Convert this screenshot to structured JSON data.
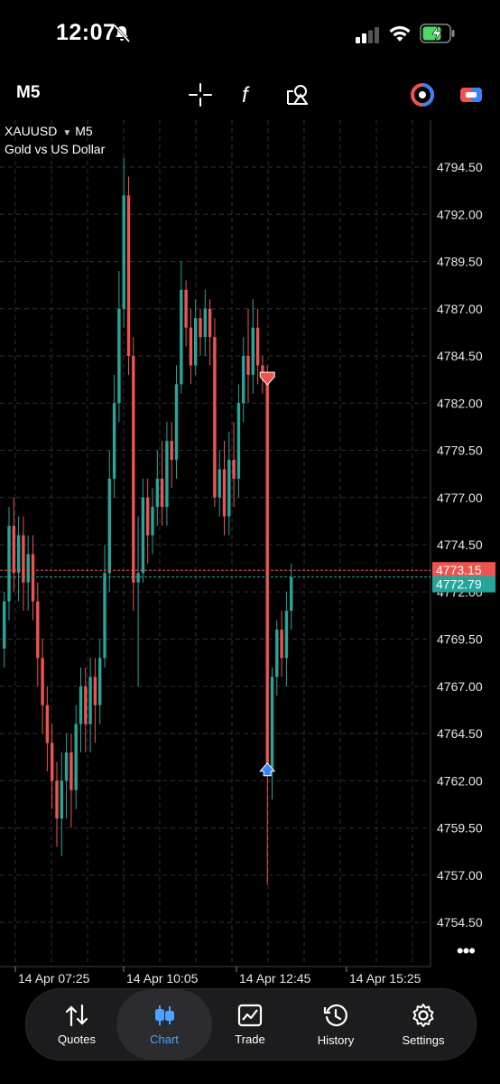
{
  "status_bar": {
    "time": "12:07",
    "icons": [
      "bell-slash-icon",
      "signal-icon",
      "wifi-icon",
      "battery-charging-icon"
    ]
  },
  "toolbar": {
    "timeframe": "M5",
    "icons": [
      "crosshair-icon",
      "indicators-icon",
      "objects-icon",
      "trade-toggle-icon",
      "one-click-trading-icon"
    ]
  },
  "chart": {
    "symbol": "XAUUSD",
    "timeframe": "M5",
    "description": "Gold vs US Dollar",
    "price_labels": [
      "4794.50",
      "4792.00",
      "4789.50",
      "4787.00",
      "4784.50",
      "4782.00",
      "4779.50",
      "4777.00",
      "4774.50",
      "4772.00",
      "4769.50",
      "4767.00",
      "4764.50",
      "4762.00",
      "4759.50",
      "4757.00",
      "4754.50"
    ],
    "time_labels": [
      "14 Apr 07:25",
      "14 Apr 10:05",
      "14 Apr 12:45",
      "14 Apr 15:25"
    ],
    "ask_price": "4773.15",
    "bid_price": "4772.79",
    "colors": {
      "bull": "#26a69a",
      "bear": "#ef5350",
      "grid": "#2a2f3a",
      "ask_line": "#ef5350",
      "bid_line": "#26a69a"
    }
  },
  "chart_data": {
    "type": "candlestick",
    "symbol": "XAUUSD",
    "timeframe": "M5",
    "ylim": [
      4753.5,
      4796.5
    ],
    "x_ticks": [
      "14 Apr 07:25",
      "14 Apr 10:05",
      "14 Apr 12:45",
      "14 Apr 15:25"
    ],
    "candles": [
      [
        4769,
        4771.5,
        4768,
        4772
      ],
      [
        4771.5,
        4775.5,
        4770.5,
        4776.5
      ],
      [
        4775.5,
        4773,
        4772,
        4777
      ],
      [
        4773,
        4775,
        4771.5,
        4776
      ],
      [
        4775,
        4772.5,
        4771,
        4776
      ],
      [
        4772.5,
        4774,
        4771,
        4775
      ],
      [
        4774,
        4771.5,
        4770.5,
        4775
      ],
      [
        4771.5,
        4768.5,
        4767,
        4772.5
      ],
      [
        4768.5,
        4766,
        4764.5,
        4769.5
      ],
      [
        4766,
        4764,
        4762.5,
        4767
      ],
      [
        4764,
        4762,
        4760.5,
        4765
      ],
      [
        4762,
        4760,
        4758.5,
        4763
      ],
      [
        4760,
        4762,
        4758,
        4763.5
      ],
      [
        4762,
        4763.5,
        4760,
        4764.5
      ],
      [
        4763.5,
        4761.5,
        4759.5,
        4764.5
      ],
      [
        4761.5,
        4765,
        4760.5,
        4766
      ],
      [
        4765,
        4767,
        4763.5,
        4768
      ],
      [
        4767,
        4765,
        4763.5,
        4768
      ],
      [
        4765,
        4767.5,
        4763.5,
        4768.5
      ],
      [
        4767.5,
        4766,
        4764,
        4768.5
      ],
      [
        4766,
        4768.5,
        4765,
        4769.5
      ],
      [
        4768.5,
        4773,
        4768,
        4774.5
      ],
      [
        4773,
        4778,
        4772,
        4779.5
      ],
      [
        4778,
        4782,
        4777,
        4783.5
      ],
      [
        4782,
        4787,
        4781,
        4789
      ],
      [
        4787,
        4793,
        4786,
        4795
      ],
      [
        4793,
        4784.5,
        4783.5,
        4794
      ],
      [
        4784.5,
        4772.5,
        4771,
        4785.5
      ],
      [
        4772.5,
        4773,
        4767,
        4776
      ],
      [
        4773,
        4777,
        4772.5,
        4778
      ],
      [
        4777,
        4775,
        4773.5,
        4778
      ],
      [
        4775,
        4776.5,
        4774,
        4777.5
      ],
      [
        4776.5,
        4778,
        4775.5,
        4779.5
      ],
      [
        4778,
        4776.5,
        4775.5,
        4780
      ],
      [
        4776.5,
        4780,
        4775.5,
        4781
      ],
      [
        4780,
        4779,
        4777.5,
        4781
      ],
      [
        4779,
        4783,
        4778,
        4784
      ],
      [
        4783,
        4788,
        4782.5,
        4789.5
      ],
      [
        4788,
        4786,
        4785,
        4788.5
      ],
      [
        4786,
        4784,
        4783,
        4787
      ],
      [
        4784,
        4786.5,
        4783.5,
        4787.5
      ],
      [
        4786.5,
        4785.5,
        4784.5,
        4787
      ],
      [
        4785.5,
        4787,
        4784.5,
        4788
      ],
      [
        4787,
        4785.5,
        4784,
        4787.5
      ],
      [
        4785.5,
        4777,
        4776.5,
        4786.5
      ],
      [
        4777,
        4778.5,
        4776,
        4779.5
      ],
      [
        4778.5,
        4776,
        4775,
        4780
      ],
      [
        4776,
        4779,
        4775,
        4780.5
      ],
      [
        4779,
        4778,
        4776.5,
        4781
      ],
      [
        4778,
        4782,
        4777,
        4783
      ],
      [
        4782,
        4784.5,
        4781,
        4785.5
      ],
      [
        4784.5,
        4783.5,
        4782,
        4787
      ],
      [
        4783.5,
        4786,
        4782.5,
        4787.5
      ],
      [
        4786,
        4784,
        4783,
        4787
      ],
      [
        4784,
        4783.5,
        4782.5,
        4784.5
      ],
      [
        4783.5,
        4762.5,
        4756.5,
        4784
      ],
      [
        4762.5,
        4767.5,
        4761,
        4768
      ],
      [
        4767.5,
        4770,
        4766.5,
        4770.5
      ],
      [
        4770,
        4768.5,
        4767.5,
        4771
      ],
      [
        4768.5,
        4771,
        4767,
        4772
      ],
      [
        4771,
        4772.79,
        4770,
        4773.5
      ]
    ],
    "markers": [
      {
        "type": "sell",
        "price": 4783.3
      },
      {
        "type": "buy",
        "price": 4762.5
      }
    ],
    "ask": 4773.15,
    "bid": 4772.79
  },
  "tabs": [
    {
      "label": "Quotes",
      "icon": "quotes-arrows-icon"
    },
    {
      "label": "Chart",
      "icon": "chart-candles-icon",
      "active": true
    },
    {
      "label": "Trade",
      "icon": "trade-chart-icon"
    },
    {
      "label": "History",
      "icon": "history-clock-icon"
    },
    {
      "label": "Settings",
      "icon": "settings-gear-icon"
    }
  ],
  "more_label": "•••"
}
